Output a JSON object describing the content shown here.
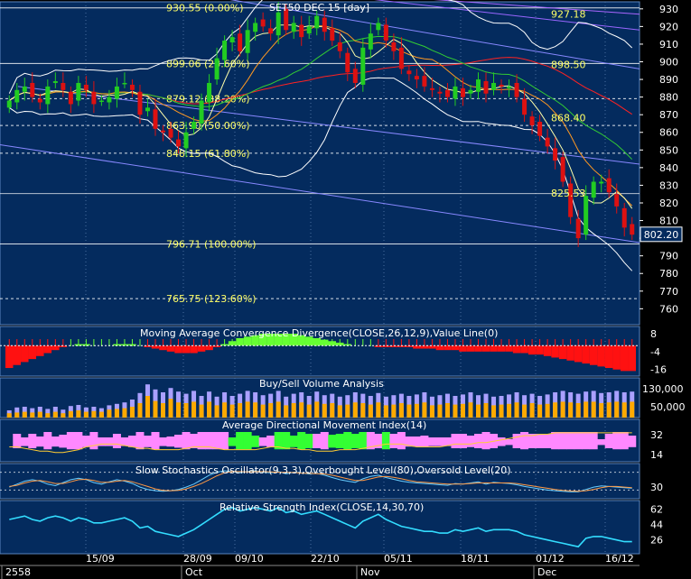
{
  "colors": {
    "panel_bg": "#042b5e",
    "grid": "#3a6aa0",
    "axis_text": "#ffffff",
    "up_candle": "#22cc22",
    "down_candle": "#dd1111",
    "fib_text": "#ffff66",
    "trend_line": "#8888ff",
    "bb_line": "#ffffff",
    "ma_red": "#ff2222",
    "ma_green": "#33cc33",
    "ma_orange": "#ff9922",
    "macd_pos": "#66ff33",
    "macd_neg": "#ff1111",
    "vol_buy": "#aaa0ff",
    "vol_sell": "#ffaa00",
    "adx_pos": "#ff88ff",
    "adx_neg": "#33ff33",
    "rsi": "#33ddff",
    "sto_k": "#66ccff",
    "sto_d": "#ff9944"
  },
  "chart_data": {
    "type": "candlestick",
    "title": "SET50 DEC 15   [day]",
    "y_axis_ticks": [
      930,
      920,
      910,
      900,
      890,
      880,
      870,
      860,
      850,
      840,
      830,
      820,
      810,
      800,
      790,
      780,
      770,
      760
    ],
    "ylim": [
      752,
      934
    ],
    "last_price_label": "802.20",
    "fib_levels": [
      {
        "label": "930.55 (0.00%)",
        "value": 930.55
      },
      {
        "label": "899.06 (23.60%)",
        "value": 899.06
      },
      {
        "label": "879.12 (38.20%)",
        "value": 879.12
      },
      {
        "label": "863.90 (50.00%)",
        "value": 863.9
      },
      {
        "label": "848.15 (61.80%)",
        "value": 848.15
      },
      {
        "label": "796.71 (100.00%)",
        "value": 796.71
      },
      {
        "label": "765.75 (123.60%)",
        "value": 765.75
      }
    ],
    "right_labels": [
      {
        "label": "927.18",
        "value": 927.18
      },
      {
        "label": "898.50",
        "value": 898.5
      },
      {
        "label": "868.40",
        "value": 868.4
      },
      {
        "label": "825.53",
        "value": 825.53
      }
    ],
    "x_date_labels": [
      "15/09",
      "28/09",
      "09/10",
      "22/10",
      "05/11",
      "18/11",
      "01/12",
      "16/12"
    ],
    "x_month_labels": [
      "2558",
      "Oct",
      "Nov",
      "Dec"
    ],
    "closes": [
      878,
      884,
      886,
      880,
      877,
      886,
      889,
      884,
      876,
      888,
      884,
      876,
      878,
      880,
      886,
      888,
      884,
      870,
      874,
      862,
      860,
      857,
      852,
      860,
      866,
      878,
      888,
      902,
      912,
      914,
      906,
      918,
      922,
      920,
      916,
      928,
      918,
      922,
      914,
      920,
      926,
      917,
      912,
      906,
      894,
      888,
      908,
      916,
      922,
      912,
      906,
      896,
      893,
      890,
      886,
      884,
      882,
      880,
      886,
      880,
      884,
      890,
      882,
      888,
      886,
      886,
      880,
      870,
      864,
      858,
      852,
      844,
      832,
      812,
      800,
      824,
      832,
      832,
      826,
      818,
      806,
      802
    ],
    "macd_ticks": [
      "8",
      "-4",
      "-16"
    ],
    "macd_values": [
      -15,
      -13,
      -11,
      -9,
      -7,
      -5,
      -3,
      -1,
      0,
      1,
      1,
      0,
      0,
      0,
      1,
      1,
      1,
      0,
      -1,
      -2,
      -3,
      -4,
      -5,
      -5,
      -5,
      -4,
      -3,
      -1,
      1,
      3,
      5,
      6,
      7,
      8,
      8,
      8,
      8,
      8,
      7,
      6,
      5,
      4,
      3,
      2,
      1,
      0,
      0,
      0,
      -1,
      -1,
      -1,
      -1,
      -1,
      -2,
      -2,
      -2,
      -3,
      -3,
      -3,
      -4,
      -4,
      -4,
      -4,
      -4,
      -4,
      -4,
      -5,
      -5,
      -6,
      -6,
      -7,
      -8,
      -9,
      -10,
      -11,
      -12,
      -13,
      -14,
      -15,
      -16,
      -17,
      -17
    ],
    "panels": [
      {
        "title": "Moving Average Convergence Divergence(CLOSE,26,12,9),Value Line(0)",
        "ticks": [
          "8",
          "-4",
          "-16"
        ]
      },
      {
        "title": "Buy/Sell Volume Analysis",
        "ticks": [
          "130,000",
          "50,000"
        ]
      },
      {
        "title": "Average Directional Movement Index(14)",
        "ticks": [
          "32",
          "14"
        ]
      },
      {
        "title": "Slow Stochastics Oscillator(9,3,3),Overbought Level(80),Oversold Level(20)",
        "ticks": [
          "30"
        ]
      },
      {
        "title": "Relative Strength Index(CLOSE,14,30,70)",
        "ticks": [
          "62",
          "44",
          "26"
        ]
      }
    ],
    "volume_buy": [
      20,
      28,
      30,
      26,
      30,
      24,
      30,
      22,
      32,
      35,
      28,
      30,
      26,
      34,
      38,
      42,
      50,
      68,
      92,
      78,
      70,
      82,
      72,
      66,
      74,
      60,
      72,
      58,
      70,
      60,
      66,
      74,
      70,
      62,
      66,
      74,
      58,
      66,
      70,
      60,
      72,
      62,
      66,
      58,
      62,
      70,
      66,
      60,
      68,
      58,
      62,
      66,
      60,
      64,
      70,
      58,
      62,
      66,
      60,
      64,
      70,
      62,
      66,
      58,
      60,
      64,
      70,
      62,
      66,
      60,
      64,
      70,
      74,
      70,
      66,
      72,
      74,
      68,
      70,
      74,
      70,
      72
    ],
    "volume_sell": [
      12,
      14,
      16,
      14,
      16,
      12,
      16,
      12,
      18,
      20,
      16,
      18,
      16,
      22,
      24,
      26,
      30,
      40,
      60,
      46,
      40,
      52,
      42,
      40,
      44,
      36,
      44,
      34,
      42,
      36,
      40,
      44,
      42,
      36,
      40,
      44,
      34,
      40,
      42,
      36,
      44,
      38,
      40,
      34,
      36,
      42,
      40,
      36,
      42,
      34,
      36,
      40,
      36,
      38,
      42,
      34,
      36,
      40,
      36,
      38,
      42,
      36,
      40,
      34,
      36,
      38,
      42,
      36,
      40,
      36,
      38,
      42,
      44,
      42,
      40,
      44,
      44,
      40,
      42,
      44,
      42,
      44
    ],
    "adx_values": [
      18,
      18,
      17,
      16,
      15,
      15,
      14,
      14,
      15,
      16,
      18,
      19,
      20,
      20,
      20,
      19,
      18,
      17,
      17,
      16,
      16,
      16,
      16,
      17,
      18,
      18,
      18,
      17,
      16,
      16,
      16,
      16,
      16,
      17,
      18,
      18,
      17,
      17,
      16,
      16,
      15,
      15,
      15,
      16,
      16,
      16,
      17,
      18,
      19,
      20,
      20,
      20,
      19,
      18,
      18,
      18,
      18,
      19,
      20,
      20,
      20,
      21,
      21,
      22,
      23,
      24,
      25,
      26,
      26,
      27,
      27,
      28,
      28,
      28,
      28,
      28,
      28,
      28,
      28,
      28,
      28,
      28
    ],
    "sto_k": [
      30,
      40,
      50,
      55,
      50,
      40,
      35,
      45,
      55,
      60,
      55,
      45,
      40,
      48,
      55,
      50,
      42,
      30,
      22,
      18,
      16,
      18,
      22,
      30,
      40,
      55,
      70,
      80,
      85,
      82,
      78,
      82,
      85,
      80,
      78,
      82,
      75,
      80,
      78,
      74,
      76,
      70,
      62,
      55,
      50,
      46,
      58,
      66,
      70,
      62,
      56,
      50,
      46,
      44,
      42,
      40,
      38,
      36,
      42,
      40,
      44,
      48,
      40,
      46,
      44,
      42,
      38,
      32,
      28,
      24,
      20,
      18,
      16,
      14,
      14,
      22,
      30,
      34,
      32,
      30,
      28,
      26
    ],
    "sto_d": [
      32,
      36,
      44,
      50,
      52,
      48,
      42,
      42,
      48,
      55,
      56,
      52,
      46,
      46,
      50,
      52,
      48,
      40,
      32,
      24,
      19,
      18,
      19,
      24,
      32,
      42,
      55,
      68,
      78,
      82,
      82,
      81,
      82,
      82,
      81,
      80,
      79,
      79,
      77,
      76,
      75,
      74,
      70,
      64,
      58,
      52,
      52,
      58,
      64,
      66,
      63,
      58,
      52,
      48,
      46,
      44,
      42,
      40,
      40,
      40,
      42,
      44,
      44,
      44,
      44,
      44,
      42,
      38,
      34,
      30,
      26,
      22,
      19,
      17,
      16,
      18,
      22,
      28,
      32,
      32,
      30,
      28
    ],
    "rsi_values": [
      50,
      52,
      54,
      50,
      48,
      52,
      54,
      52,
      48,
      52,
      50,
      46,
      46,
      48,
      50,
      52,
      48,
      40,
      42,
      36,
      34,
      32,
      30,
      34,
      38,
      44,
      50,
      56,
      62,
      64,
      60,
      62,
      64,
      62,
      60,
      64,
      58,
      60,
      56,
      58,
      60,
      56,
      52,
      48,
      44,
      40,
      48,
      52,
      56,
      50,
      46,
      42,
      40,
      38,
      36,
      36,
      34,
      34,
      38,
      36,
      38,
      40,
      36,
      38,
      38,
      38,
      36,
      32,
      30,
      28,
      26,
      24,
      22,
      20,
      18,
      28,
      30,
      30,
      28,
      26,
      24,
      24
    ]
  }
}
